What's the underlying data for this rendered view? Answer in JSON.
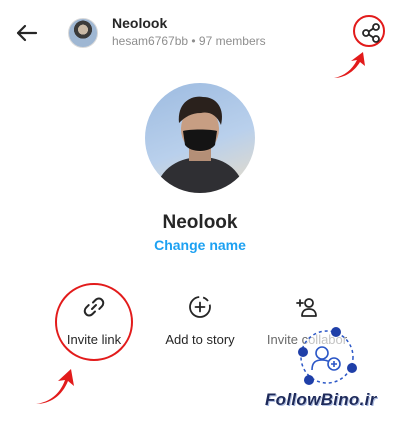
{
  "header": {
    "title": "Neolook",
    "subtitle": "hesam6767bb • 97 members"
  },
  "profile": {
    "name": "Neolook",
    "change_name": "Change name"
  },
  "actions": [
    {
      "label": "Invite link",
      "icon": "link-icon"
    },
    {
      "label": "Add to story",
      "icon": "add-to-story-icon"
    },
    {
      "label": "Invite collabor",
      "icon": "add-person-icon"
    }
  ],
  "watermark": {
    "text": "FollowBino.ir"
  },
  "colors": {
    "highlight": "#e21b1b",
    "link": "#1da1f2"
  }
}
